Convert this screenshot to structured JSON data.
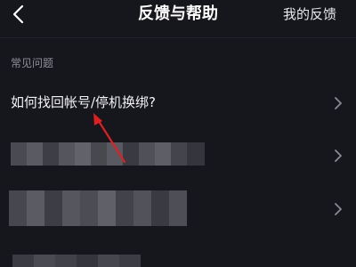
{
  "nav": {
    "title": "反馈与帮助",
    "my_feedback": "我的反馈",
    "back_icon": "chevron-left-icon"
  },
  "faq": {
    "section_label": "常见问题",
    "items": [
      {
        "label": "如何找回帐号/停机换绑?"
      },
      {
        "label": ""
      },
      {
        "label": ""
      },
      {
        "label": ""
      }
    ]
  },
  "colors": {
    "background": "#16161d",
    "text": "#f2f2f5",
    "muted": "#8f8f99",
    "annotation": "#e02020"
  }
}
